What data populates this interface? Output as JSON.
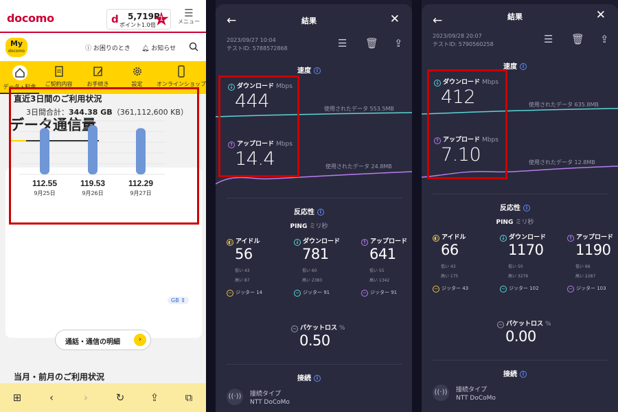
{
  "docomo": {
    "logo": "docomo",
    "points_value": "5,719P",
    "points_sub": "ポイント1.0倍",
    "star_badge": "1",
    "menu_label": "メニュー",
    "my_logo": "My",
    "my_logo_sub": "docomo",
    "help_link": "お困りのとき",
    "notice_link": "お知らせ",
    "nav": [
      {
        "label": "データ・料金",
        "icon": "home-icon"
      },
      {
        "label": "ご契約内容",
        "icon": "contract-icon"
      },
      {
        "label": "お手続き",
        "icon": "procedure-icon"
      },
      {
        "label": "設定",
        "icon": "settings-icon"
      },
      {
        "label": "オンラインショップ",
        "icon": "phone-icon"
      }
    ],
    "page_title": "データ通信量",
    "usage_title": "直近3日間のご利用状況",
    "total_label": "3日間合計：",
    "total_value": "344.38 GB",
    "total_kb": "（361,112,600 KB）",
    "unit_select": "GB",
    "detail_button": "通話・通信の明細",
    "prev_title": "当月・前月のご利用状況",
    "colors": {
      "brand": "#cc0033",
      "nav_bg": "#ffd200",
      "bar": "#6f96d6"
    }
  },
  "chart_data": {
    "type": "bar",
    "categories": [
      "9月25日",
      "9月26日",
      "9月27日"
    ],
    "values": [
      112.55,
      119.53,
      112.29
    ],
    "value_labels": [
      "112.55",
      "119.53",
      "112.29"
    ],
    "ylim": [
      0,
      130
    ],
    "grid": true
  },
  "tests": [
    {
      "header": "結果",
      "datetime": "2023/09/27 10:04",
      "test_id": "テストID: 5788572868",
      "speed_title": "速度",
      "download_label": "ダウンロード",
      "upload_label": "アップロード",
      "unit": "Mbps",
      "download": "444",
      "upload": "14.4",
      "download_used": "使用されたデータ 553.5MB",
      "upload_used": "使用されたデータ 24.8MB",
      "response_title": "反応性",
      "ping_label": "PING",
      "ping_unit": "ミリ秒",
      "idle_label": "アイドル",
      "idle": "56",
      "idle_low": "低い 43",
      "idle_high": "高い 87",
      "idle_jitter": "ジッター 14",
      "ping_dl": "781",
      "ping_dl_low": "低い 60",
      "ping_dl_high": "高い 2383",
      "ping_dl_jitter": "ジッター 91",
      "ping_ul": "641",
      "ping_ul_low": "低い 55",
      "ping_ul_high": "高い 1342",
      "ping_ul_jitter": "ジッター 91",
      "loss_label": "パケットロス",
      "loss_unit": "%",
      "loss": "0.50",
      "conn_title": "接続",
      "conn_type_label": "接続タイプ",
      "conn_type": "NTT DoCoMo"
    },
    {
      "header": "結果",
      "datetime": "2023/09/28 20:07",
      "test_id": "テストID: 5790560258",
      "speed_title": "速度",
      "download_label": "ダウンロード",
      "upload_label": "アップロード",
      "unit": "Mbps",
      "download": "412",
      "upload": "7.10",
      "download_used": "使用されたデータ 635.8MB",
      "upload_used": "使用されたデータ 12.8MB",
      "response_title": "反応性",
      "ping_label": "PING",
      "ping_unit": "ミリ秒",
      "idle_label": "アイドル",
      "idle": "66",
      "idle_low": "低い 43",
      "idle_high": "高い 175",
      "idle_jitter": "ジッター 43",
      "ping_dl": "1170",
      "ping_dl_low": "低い 50",
      "ping_dl_high": "高い 3276",
      "ping_dl_jitter": "ジッター 102",
      "ping_ul": "1190",
      "ping_ul_low": "低い 66",
      "ping_ul_high": "高い 2287",
      "ping_ul_jitter": "ジッター 103",
      "loss_label": "パケットロス",
      "loss_unit": "%",
      "loss": "0.00",
      "conn_title": "接続",
      "conn_type_label": "接続タイプ",
      "conn_type": "NTT DoCoMo"
    }
  ],
  "speedtest_colors": {
    "download": "#5ad7d7",
    "upload": "#b77ef0",
    "idle": "#e8c552",
    "highlight": "#cc0000"
  }
}
